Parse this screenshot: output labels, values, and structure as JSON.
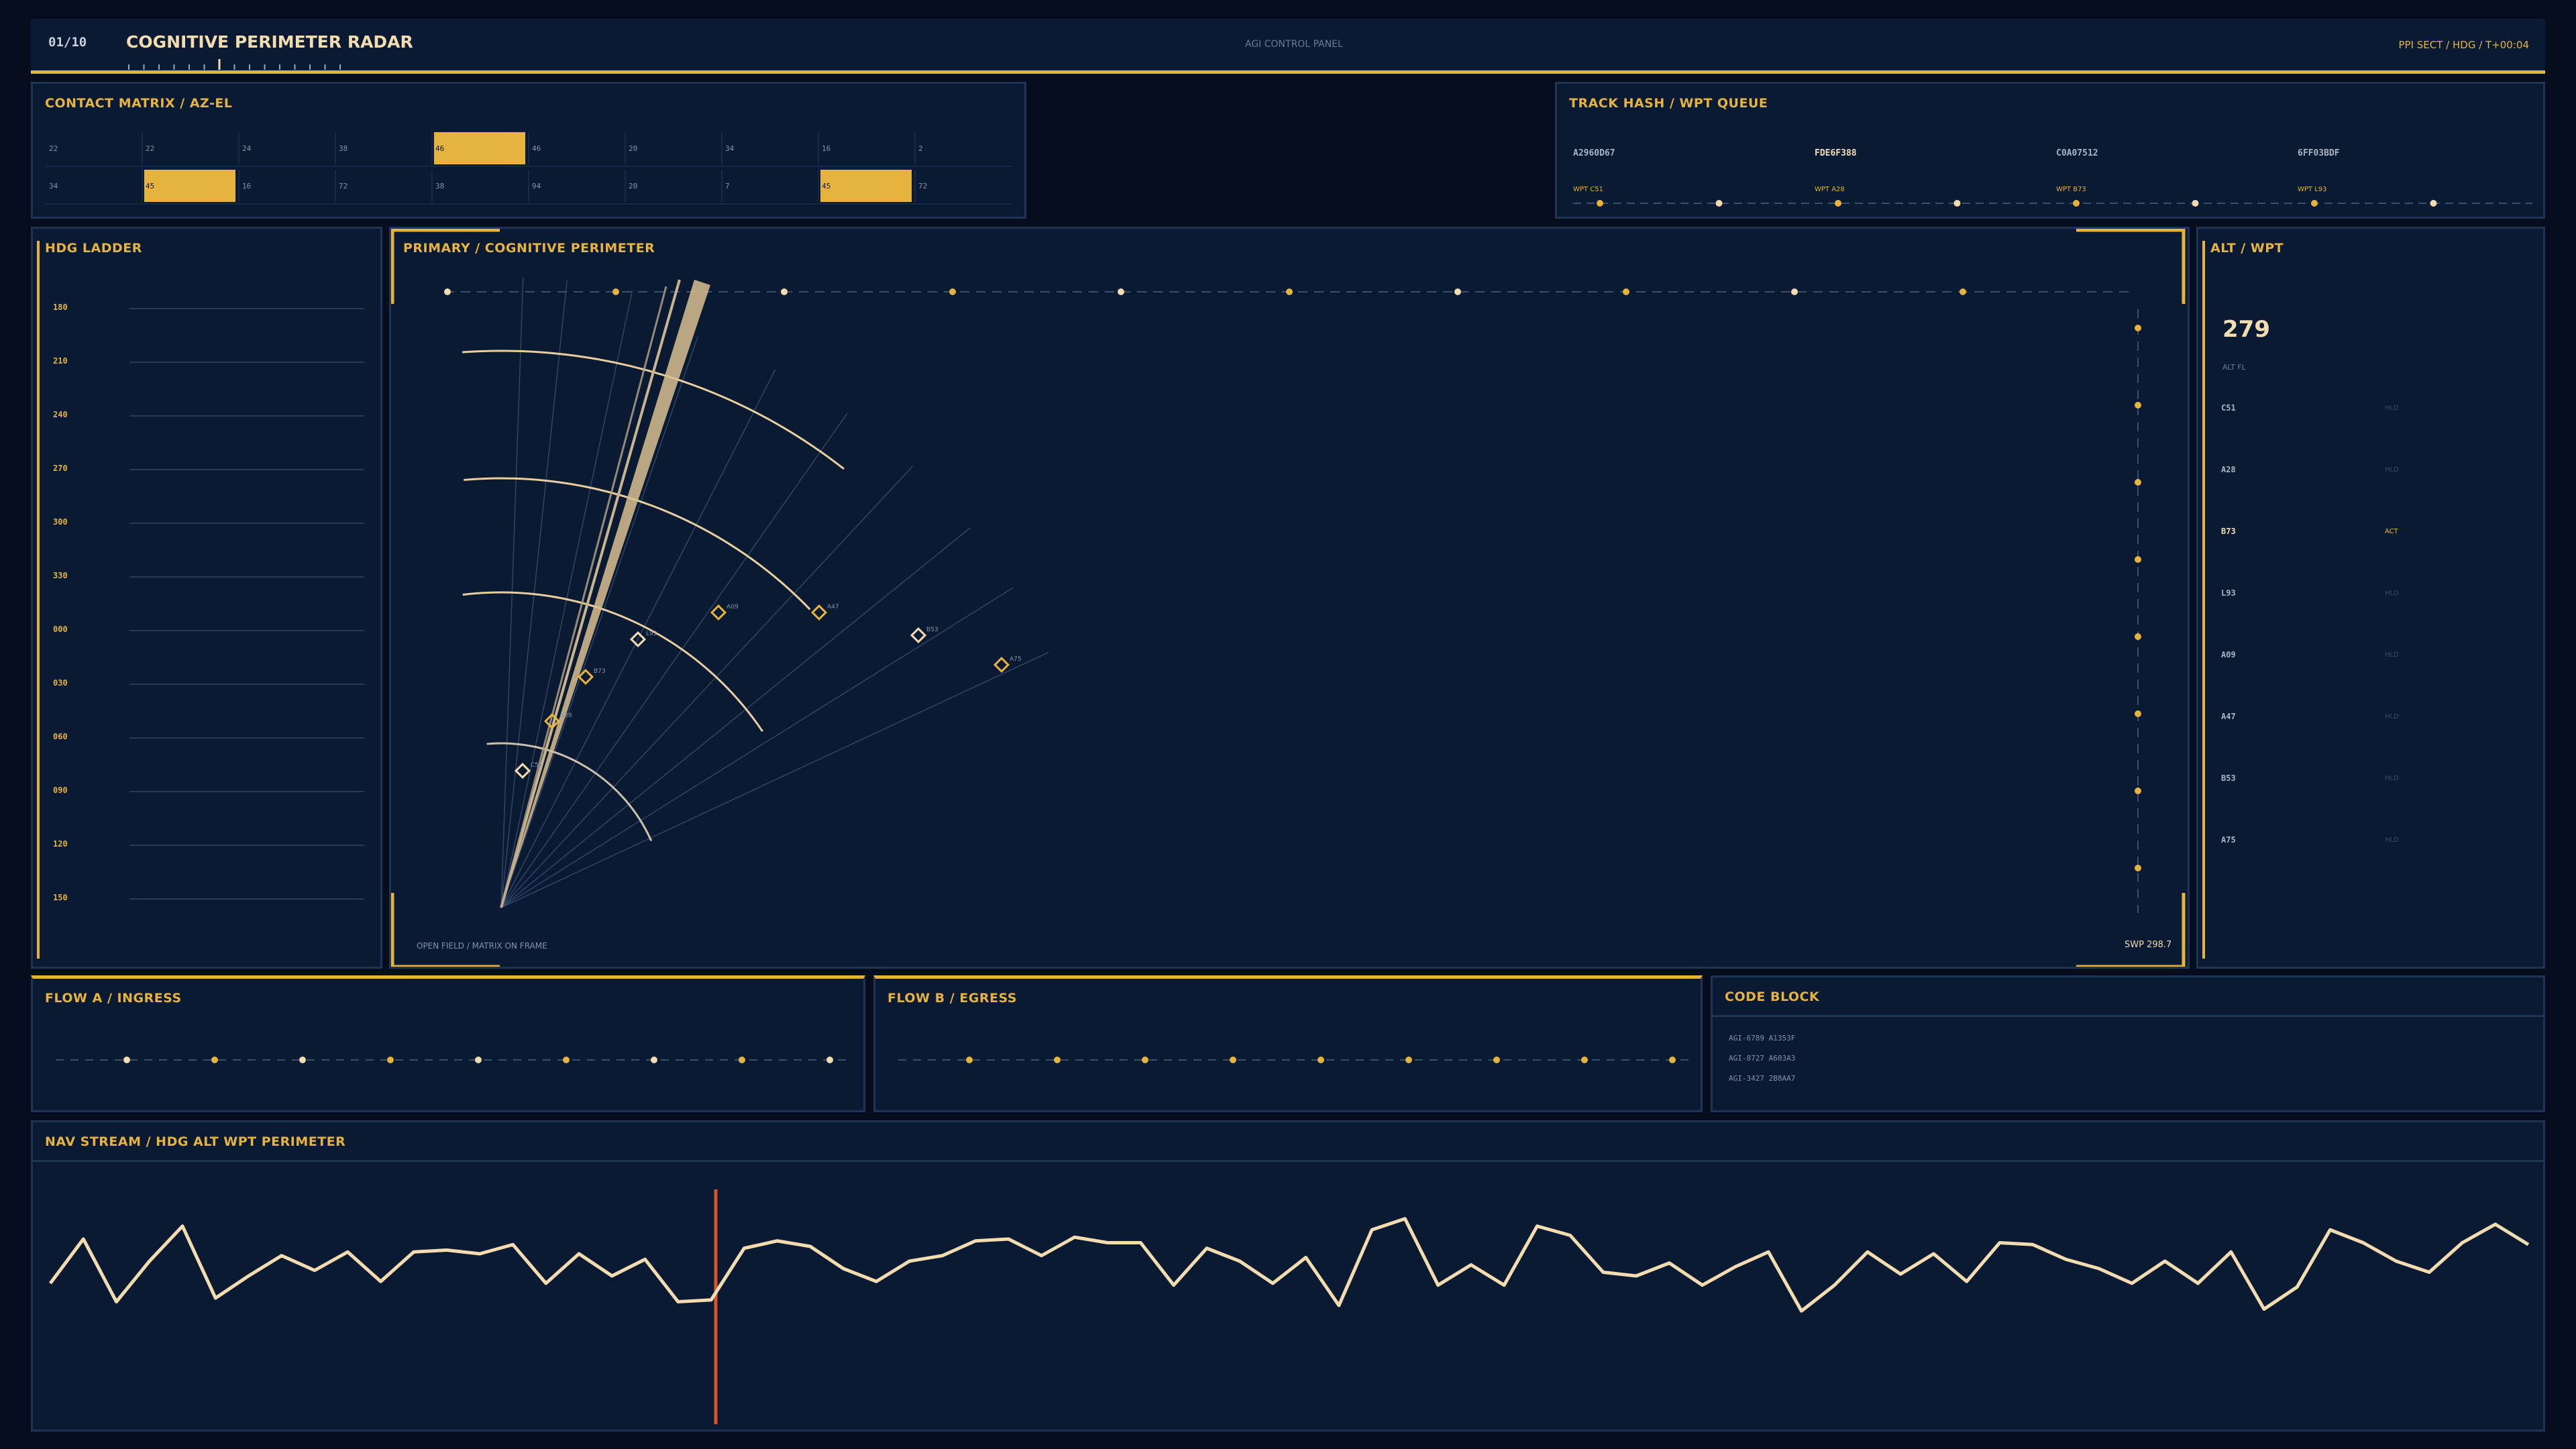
{
  "header": {
    "index": "01/10",
    "title": "COGNITIVE PERIMETER RADAR",
    "center": "AGI CONTROL PANEL",
    "status": "PPI SECT  /  HDG  /  T+00:04"
  },
  "contact": {
    "title": "CONTACT MATRIX  /  AZ-EL",
    "rows": [
      [
        "22",
        "22",
        "24",
        "38",
        "46",
        "46",
        "20",
        "34",
        "16",
        "2"
      ],
      [
        "34",
        "45",
        "16",
        "72",
        "38",
        "94",
        "20",
        "7",
        "45",
        "72"
      ]
    ]
  },
  "track": {
    "title": "TRACK HASH  /  WPT QUEUE",
    "hashes": [
      "A2960D67",
      "FDE6F388",
      "C0A07512",
      "6FF03BDF"
    ],
    "wpts": [
      "WPT C51",
      "WPT A28",
      "WPT B73",
      "WPT L93"
    ]
  },
  "hdg": {
    "title": "HDG LADDER",
    "ticks": [
      "180",
      "210",
      "240",
      "270",
      "300",
      "330",
      "000",
      "030",
      "060",
      "090",
      "120",
      "150"
    ]
  },
  "primary": {
    "title": "PRIMARY  /  COGNITIVE PERIMETER",
    "footer_left": "OPEN FIELD  /  MATRIX ON FRAME",
    "footer_right": "SWP 298.7",
    "contacts": [
      "C51",
      "A28",
      "B73",
      "L93",
      "A09",
      "A47",
      "B53",
      "A75"
    ]
  },
  "alt": {
    "title": "ALT / WPT",
    "value": "279",
    "label": "ALT FL",
    "rows": [
      {
        "code": "C51",
        "state": "HLD"
      },
      {
        "code": "A28",
        "state": "HLD"
      },
      {
        "code": "B73",
        "state": "ACT"
      },
      {
        "code": "L93",
        "state": "HLD"
      },
      {
        "code": "A09",
        "state": "HLD"
      },
      {
        "code": "A47",
        "state": "HLD"
      },
      {
        "code": "B53",
        "state": "HLD"
      },
      {
        "code": "A75",
        "state": "HLD"
      }
    ]
  },
  "flow_a": {
    "title": "FLOW A  /  INGRESS"
  },
  "flow_b": {
    "title": "FLOW B  /  EGRESS"
  },
  "code": {
    "title": "CODE BLOCK",
    "lines": [
      "AGI-6789 A1353F",
      "AGI-8727 A603A3",
      "AGI-3427 2B8AA7"
    ]
  },
  "nav": {
    "title": "NAV STREAM  /  HDG  ALT  WPT  PERIMETER",
    "values": [
      40,
      64,
      30,
      52,
      71,
      32,
      44,
      55,
      47,
      57,
      41,
      57,
      58,
      56,
      61,
      40,
      56,
      44,
      53,
      30,
      31,
      59,
      63,
      60,
      48,
      41,
      52,
      55,
      63,
      64,
      55,
      65,
      62,
      62,
      39,
      59,
      52,
      40,
      54,
      28,
      69,
      75,
      39,
      50,
      39,
      71,
      66,
      46,
      44,
      51,
      39,
      49,
      57,
      25,
      39,
      57,
      45,
      56,
      41,
      62,
      61,
      53,
      48,
      40,
      52,
      40,
      57,
      26,
      38,
      69,
      62,
      52,
      46,
      62,
      72,
      61
    ]
  },
  "colors": {
    "accent": "#e6b33f",
    "cream": "#f3ddb0",
    "panel": "#0b1a33",
    "border": "#1f3555",
    "cursor": "#d8542a"
  }
}
